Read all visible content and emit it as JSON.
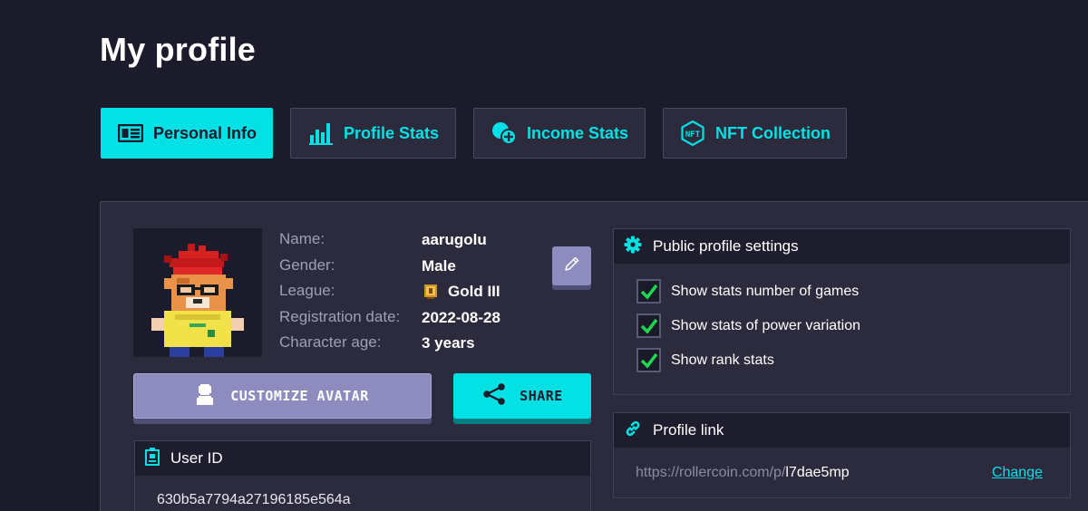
{
  "page": {
    "title": "My profile"
  },
  "tabs": [
    {
      "label": "Personal Info",
      "icon": "id-card-icon",
      "active": true
    },
    {
      "label": "Profile Stats",
      "icon": "bar-chart-icon",
      "active": false
    },
    {
      "label": "Income Stats",
      "icon": "coins-plus-icon",
      "active": false
    },
    {
      "label": "NFT Collection",
      "icon": "nft-icon",
      "active": false
    }
  ],
  "profile": {
    "labels": {
      "name": "Name:",
      "gender": "Gender:",
      "league": "League:",
      "registration_date": "Registration date:",
      "character_age": "Character age:"
    },
    "values": {
      "name": "aarugolu",
      "gender": "Male",
      "league": "Gold III",
      "registration_date": "2022-08-28",
      "character_age": "3 years"
    }
  },
  "buttons": {
    "customize_avatar": "CUSTOMIZE AVATAR",
    "share": "SHARE"
  },
  "user_id": {
    "title": "User ID",
    "value": "630b5a7794a27196185e564a"
  },
  "public_settings": {
    "title": "Public profile settings",
    "options": [
      {
        "label": "Show stats number of games",
        "checked": true
      },
      {
        "label": "Show stats of power variation",
        "checked": true
      },
      {
        "label": "Show rank stats",
        "checked": true
      }
    ]
  },
  "profile_link": {
    "title": "Profile link",
    "url_prefix": "https://rollercoin.com/p/",
    "url_code": "l7dae5mp",
    "change_label": "Change"
  },
  "colors": {
    "background": "#1c1b2b",
    "panel": "#2c2b3e",
    "accent": "#03e1e4",
    "button_purple": "#8e8cbf",
    "check_green": "#1fd84f"
  }
}
